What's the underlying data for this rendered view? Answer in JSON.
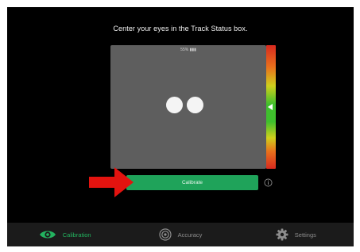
{
  "instruction": "Center your eyes in the Track Status box.",
  "track_status": {
    "readout": "55% ▮▮▮",
    "distance_level": 0.5
  },
  "calibrate_button": {
    "label": "Calibrate"
  },
  "icons": {
    "info": "info-icon",
    "arrow": "red-arrow-icon",
    "calibration": "eye-icon",
    "accuracy": "target-icon",
    "settings": "gear-icon"
  },
  "colors": {
    "accent": "#1fa35a",
    "active_tab": "#23b35f",
    "inactive_tab": "#8d8d8d",
    "arrow": "#e3130f"
  },
  "bottom_nav": {
    "items": [
      {
        "label": "Calibration",
        "active": true
      },
      {
        "label": "Accuracy",
        "active": false
      },
      {
        "label": "Settings",
        "active": false
      }
    ]
  }
}
